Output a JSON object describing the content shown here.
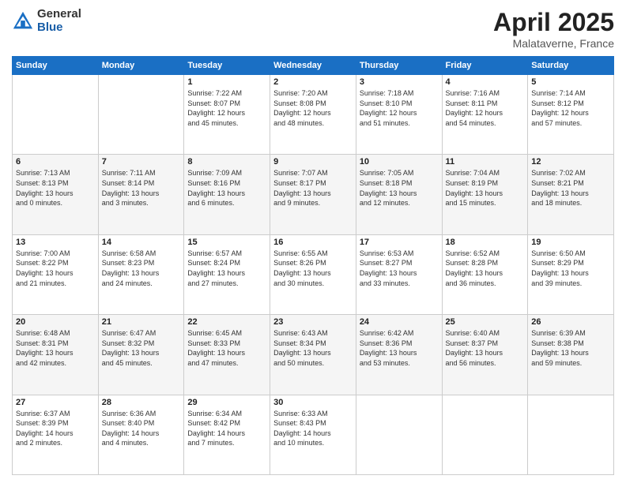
{
  "logo": {
    "general": "General",
    "blue": "Blue"
  },
  "title": {
    "month": "April 2025",
    "location": "Malataverne, France"
  },
  "weekdays": [
    "Sunday",
    "Monday",
    "Tuesday",
    "Wednesday",
    "Thursday",
    "Friday",
    "Saturday"
  ],
  "weeks": [
    [
      {
        "day": "",
        "info": ""
      },
      {
        "day": "",
        "info": ""
      },
      {
        "day": "1",
        "info": "Sunrise: 7:22 AM\nSunset: 8:07 PM\nDaylight: 12 hours\nand 45 minutes."
      },
      {
        "day": "2",
        "info": "Sunrise: 7:20 AM\nSunset: 8:08 PM\nDaylight: 12 hours\nand 48 minutes."
      },
      {
        "day": "3",
        "info": "Sunrise: 7:18 AM\nSunset: 8:10 PM\nDaylight: 12 hours\nand 51 minutes."
      },
      {
        "day": "4",
        "info": "Sunrise: 7:16 AM\nSunset: 8:11 PM\nDaylight: 12 hours\nand 54 minutes."
      },
      {
        "day": "5",
        "info": "Sunrise: 7:14 AM\nSunset: 8:12 PM\nDaylight: 12 hours\nand 57 minutes."
      }
    ],
    [
      {
        "day": "6",
        "info": "Sunrise: 7:13 AM\nSunset: 8:13 PM\nDaylight: 13 hours\nand 0 minutes."
      },
      {
        "day": "7",
        "info": "Sunrise: 7:11 AM\nSunset: 8:14 PM\nDaylight: 13 hours\nand 3 minutes."
      },
      {
        "day": "8",
        "info": "Sunrise: 7:09 AM\nSunset: 8:16 PM\nDaylight: 13 hours\nand 6 minutes."
      },
      {
        "day": "9",
        "info": "Sunrise: 7:07 AM\nSunset: 8:17 PM\nDaylight: 13 hours\nand 9 minutes."
      },
      {
        "day": "10",
        "info": "Sunrise: 7:05 AM\nSunset: 8:18 PM\nDaylight: 13 hours\nand 12 minutes."
      },
      {
        "day": "11",
        "info": "Sunrise: 7:04 AM\nSunset: 8:19 PM\nDaylight: 13 hours\nand 15 minutes."
      },
      {
        "day": "12",
        "info": "Sunrise: 7:02 AM\nSunset: 8:21 PM\nDaylight: 13 hours\nand 18 minutes."
      }
    ],
    [
      {
        "day": "13",
        "info": "Sunrise: 7:00 AM\nSunset: 8:22 PM\nDaylight: 13 hours\nand 21 minutes."
      },
      {
        "day": "14",
        "info": "Sunrise: 6:58 AM\nSunset: 8:23 PM\nDaylight: 13 hours\nand 24 minutes."
      },
      {
        "day": "15",
        "info": "Sunrise: 6:57 AM\nSunset: 8:24 PM\nDaylight: 13 hours\nand 27 minutes."
      },
      {
        "day": "16",
        "info": "Sunrise: 6:55 AM\nSunset: 8:26 PM\nDaylight: 13 hours\nand 30 minutes."
      },
      {
        "day": "17",
        "info": "Sunrise: 6:53 AM\nSunset: 8:27 PM\nDaylight: 13 hours\nand 33 minutes."
      },
      {
        "day": "18",
        "info": "Sunrise: 6:52 AM\nSunset: 8:28 PM\nDaylight: 13 hours\nand 36 minutes."
      },
      {
        "day": "19",
        "info": "Sunrise: 6:50 AM\nSunset: 8:29 PM\nDaylight: 13 hours\nand 39 minutes."
      }
    ],
    [
      {
        "day": "20",
        "info": "Sunrise: 6:48 AM\nSunset: 8:31 PM\nDaylight: 13 hours\nand 42 minutes."
      },
      {
        "day": "21",
        "info": "Sunrise: 6:47 AM\nSunset: 8:32 PM\nDaylight: 13 hours\nand 45 minutes."
      },
      {
        "day": "22",
        "info": "Sunrise: 6:45 AM\nSunset: 8:33 PM\nDaylight: 13 hours\nand 47 minutes."
      },
      {
        "day": "23",
        "info": "Sunrise: 6:43 AM\nSunset: 8:34 PM\nDaylight: 13 hours\nand 50 minutes."
      },
      {
        "day": "24",
        "info": "Sunrise: 6:42 AM\nSunset: 8:36 PM\nDaylight: 13 hours\nand 53 minutes."
      },
      {
        "day": "25",
        "info": "Sunrise: 6:40 AM\nSunset: 8:37 PM\nDaylight: 13 hours\nand 56 minutes."
      },
      {
        "day": "26",
        "info": "Sunrise: 6:39 AM\nSunset: 8:38 PM\nDaylight: 13 hours\nand 59 minutes."
      }
    ],
    [
      {
        "day": "27",
        "info": "Sunrise: 6:37 AM\nSunset: 8:39 PM\nDaylight: 14 hours\nand 2 minutes."
      },
      {
        "day": "28",
        "info": "Sunrise: 6:36 AM\nSunset: 8:40 PM\nDaylight: 14 hours\nand 4 minutes."
      },
      {
        "day": "29",
        "info": "Sunrise: 6:34 AM\nSunset: 8:42 PM\nDaylight: 14 hours\nand 7 minutes."
      },
      {
        "day": "30",
        "info": "Sunrise: 6:33 AM\nSunset: 8:43 PM\nDaylight: 14 hours\nand 10 minutes."
      },
      {
        "day": "",
        "info": ""
      },
      {
        "day": "",
        "info": ""
      },
      {
        "day": "",
        "info": ""
      }
    ]
  ]
}
